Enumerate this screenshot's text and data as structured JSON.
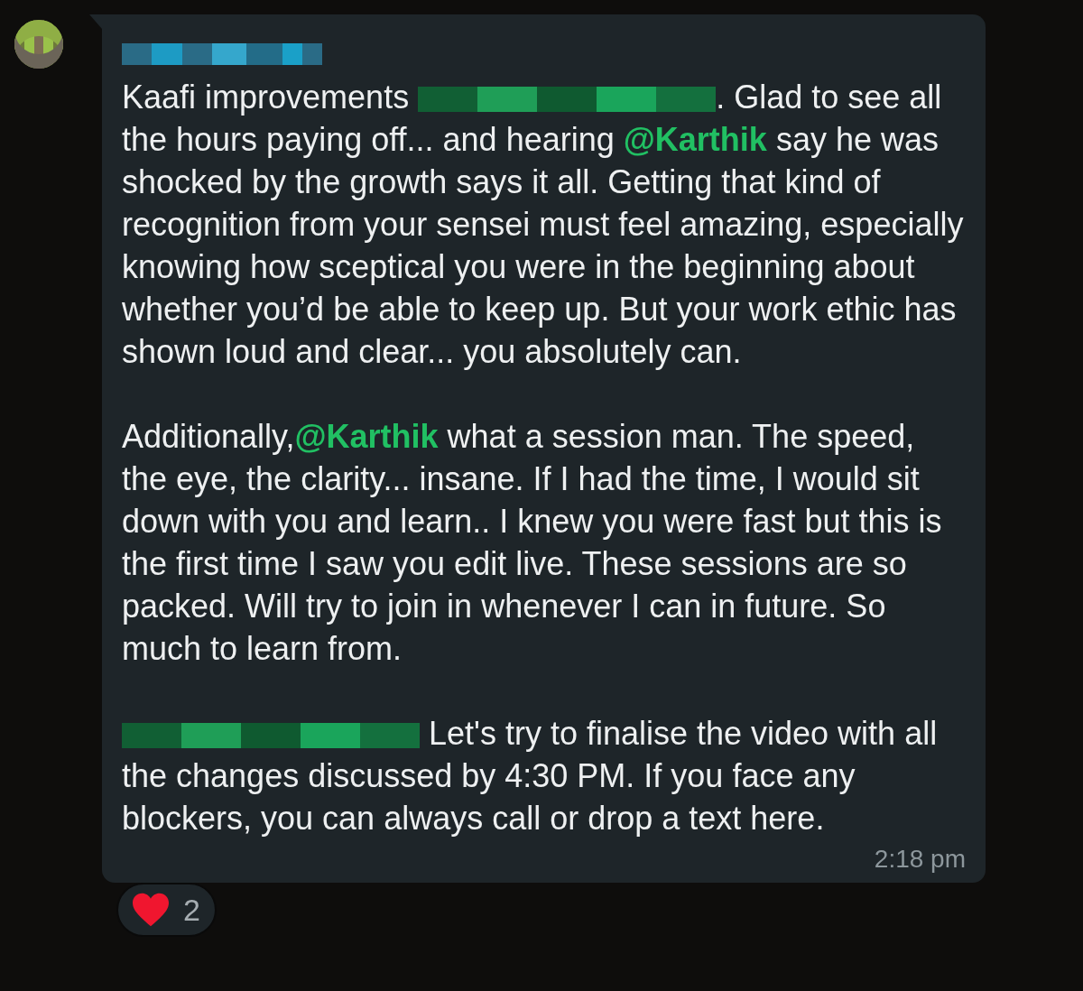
{
  "message": {
    "sender": {
      "kind": "redacted"
    },
    "paragraphs": [
      [
        {
          "kind": "text",
          "text": "Kaafi improvements "
        },
        {
          "kind": "redacted"
        },
        {
          "kind": "text",
          "text": ". Glad to see all the hours paying off... and hearing "
        },
        {
          "kind": "mention",
          "text": "@Karthik"
        },
        {
          "kind": "text",
          "text": " say he was shocked by the growth says it all. Getting that kind of recognition from your sensei must feel amazing, especially knowing how sceptical you were in the beginning about whether you’d be able to keep up. But your work ethic has shown loud and clear... you absolutely can."
        }
      ],
      [
        {
          "kind": "text",
          "text": "Additionally,"
        },
        {
          "kind": "mention",
          "text": "@Karthik"
        },
        {
          "kind": "text",
          "text": " what a session man. The speed, the eye, the clarity... insane. If I had the time, I would sit down with you and learn.. I knew you were fast but this is the first time I saw you edit live. These sessions are so packed. Will try to join in whenever I can in future. So much to learn from."
        }
      ],
      [
        {
          "kind": "redacted"
        },
        {
          "kind": "text",
          "text": " Let's try to finalise the video with all the changes discussed by 4:30 PM. If you face any blockers, you can always call or drop a text here."
        }
      ]
    ],
    "time": "2:18 pm",
    "reaction": {
      "count": "2"
    }
  }
}
